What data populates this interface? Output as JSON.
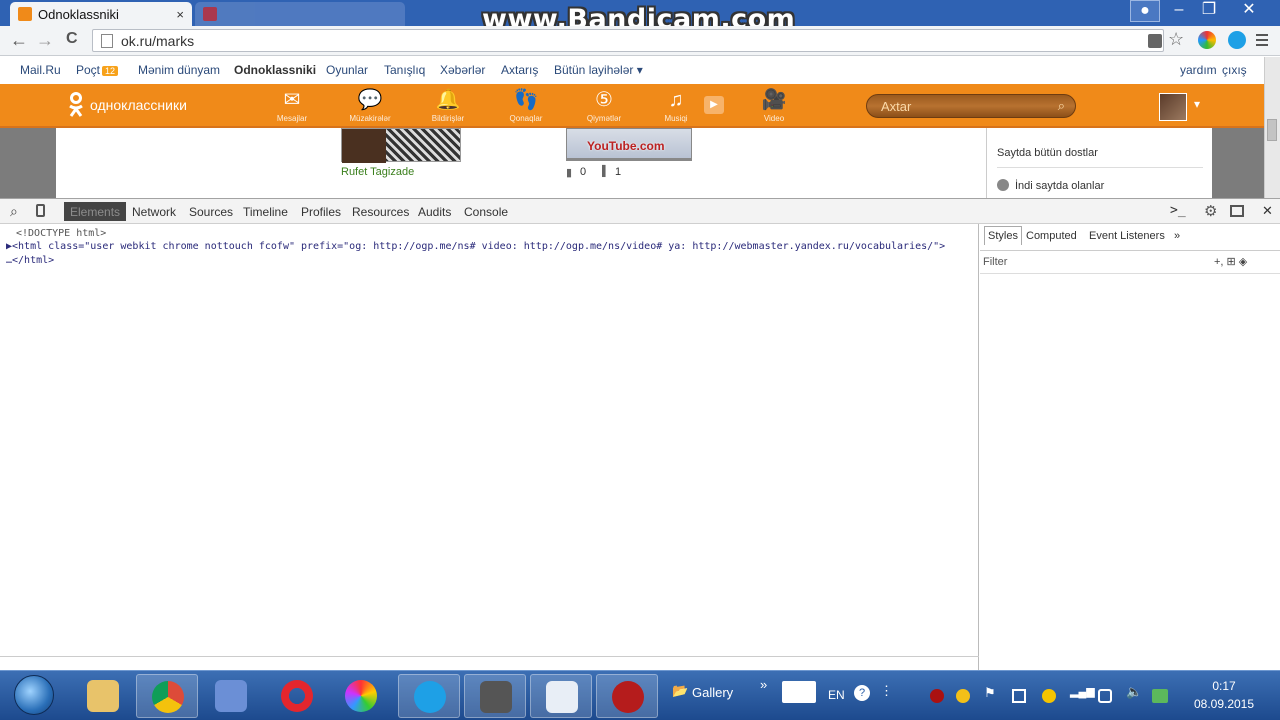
{
  "browser": {
    "active_tab": {
      "title": "Odnoklassniki",
      "close": "×"
    },
    "inactive_tab": {
      "title": ""
    },
    "watermark": "www.Bandicam.com",
    "url": "ok.ru/marks",
    "window_buttons": {
      "minimize": "–",
      "maximize": "❐",
      "close": "✕"
    },
    "nav": {
      "back": "←",
      "forward": "→",
      "reload": "C"
    }
  },
  "ok_links": {
    "mailru": "Mail.Ru",
    "poct": "Poçt",
    "poct_badge": "12",
    "menim": "Mənim dünyam",
    "odnoklassniki": "Odnoklassniki",
    "oyunlar": "Oyunlar",
    "tanisliq": "Tanışlıq",
    "xeberler": "Xəbərlər",
    "axtaris": "Axtarış",
    "butun": "Bütün layihələr",
    "butun_caret": "▾",
    "yardim": "yardım",
    "cixis": "çıxış"
  },
  "ok_bar": {
    "logo_text": "одноклассники",
    "nav": [
      {
        "label": "Mesajlar",
        "icon": "✉"
      },
      {
        "label": "Müzakirələr",
        "icon": "💬"
      },
      {
        "label": "Bildirişlər",
        "icon": "🔔"
      },
      {
        "label": "Qonaqlar",
        "icon": "👣"
      },
      {
        "label": "Qiymətlər",
        "icon": "⑤"
      },
      {
        "label": "Musiqi",
        "icon": "♫"
      },
      {
        "label": "Video",
        "icon": "🎥"
      }
    ],
    "search_placeholder": "Axtar",
    "search_icon": "⌕",
    "avatar_caret": "▾"
  },
  "content": {
    "friend_name": "Rufet Tagizade",
    "photo_caption": "YouTube.com",
    "comments_count": "0",
    "likes_count": "1",
    "sidebar_all_friends": "Saytda bütün dostlar",
    "sidebar_online": "İndi saytda olanlar"
  },
  "devtools": {
    "tabs": [
      "Elements",
      "Network",
      "Sources",
      "Timeline",
      "Profiles",
      "Resources",
      "Audits",
      "Console"
    ],
    "code": [
      "<!DOCTYPE html>",
      "▶<html class=\"user webkit chrome nottouch fcofw\" prefix=\"og: http://ogp.me/ns# video: http://ogp.me/ns/video# ya: http://webmaster.yandex.ru/vocabularies/\">",
      "…</html>"
    ],
    "side_tabs": [
      "Styles",
      "Computed",
      "Event Listeners",
      "»"
    ],
    "filter_label": "Filter",
    "filter_icons": "+, ⊞ ◈"
  },
  "taskbar": {
    "gallery_label": "Gallery",
    "more": "»",
    "lang": "EN",
    "time": "0:17",
    "date": "08.09.2015"
  }
}
